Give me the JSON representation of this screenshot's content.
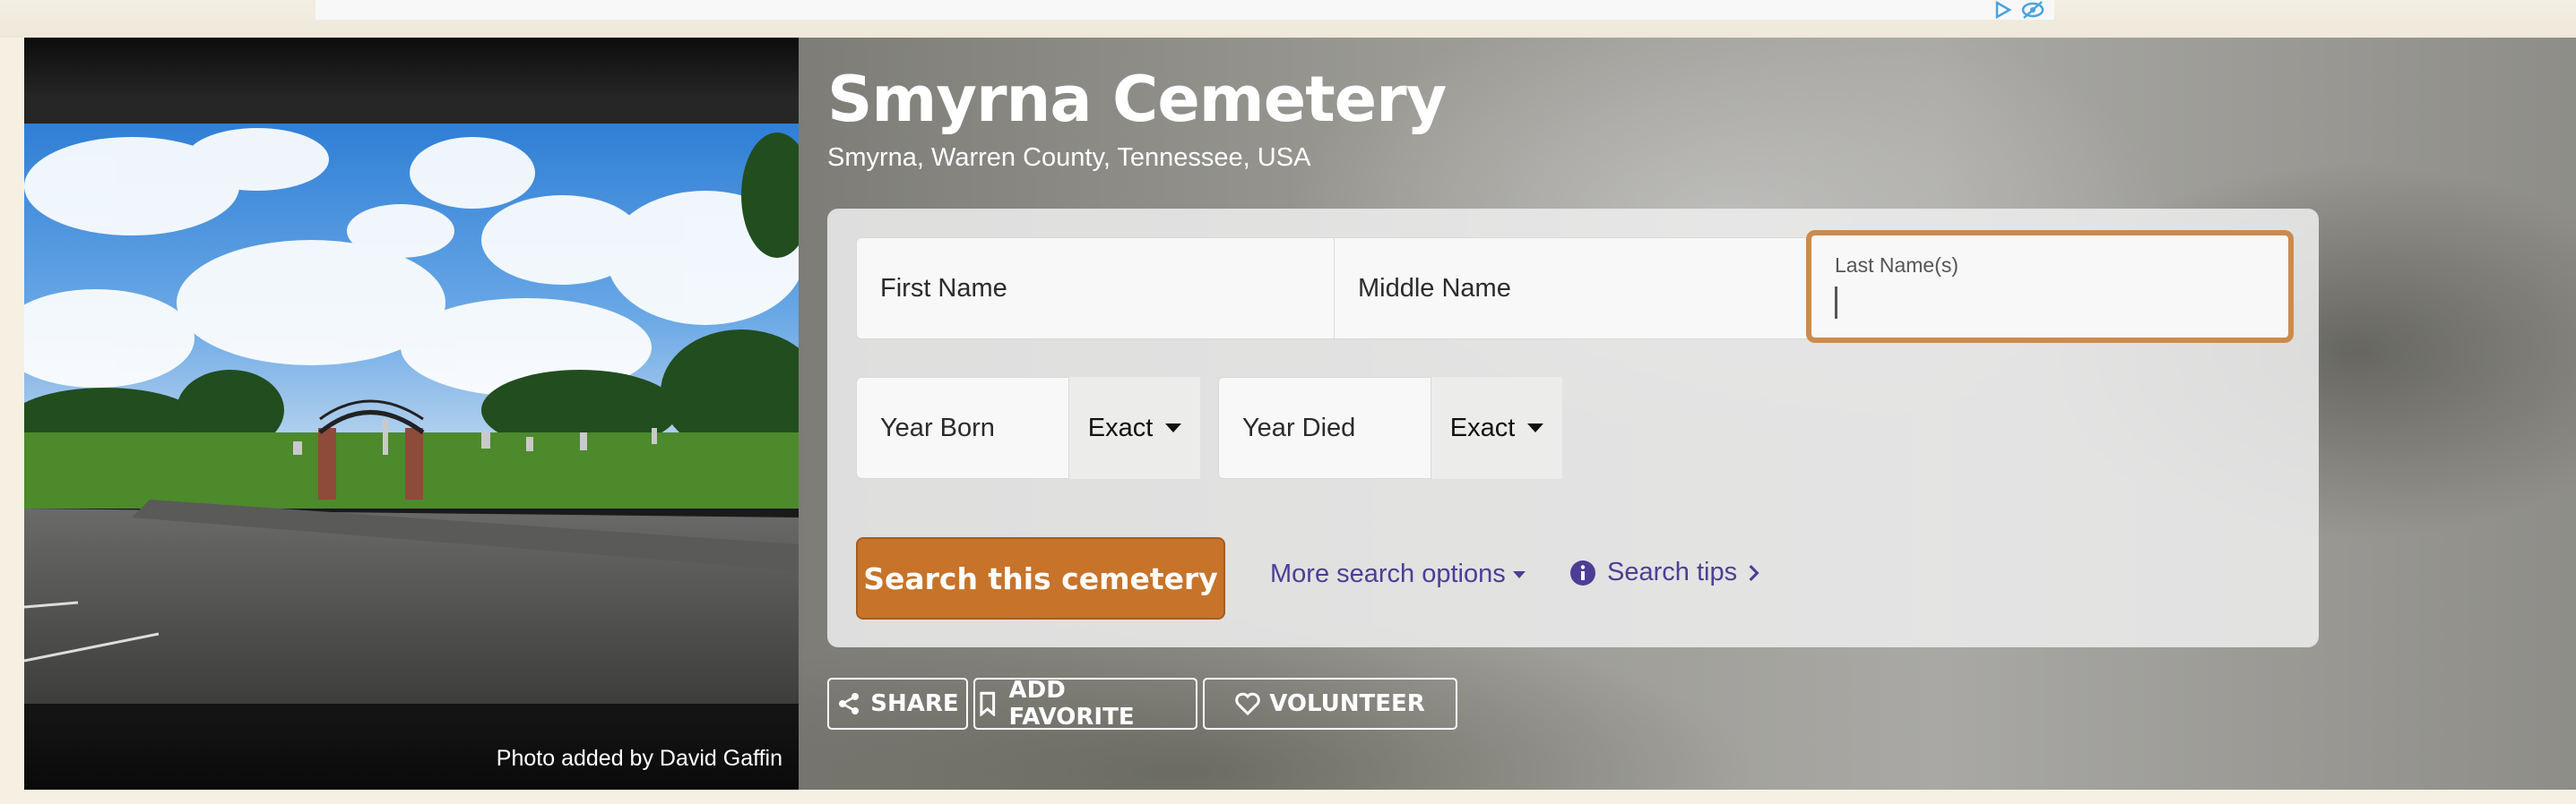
{
  "page": {
    "title": "Smyrna Cemetery",
    "location": "Smyrna, Warren County, Tennessee, USA",
    "photo_credit": "Photo added by David Gaffin"
  },
  "search": {
    "first_name_placeholder": "First Name",
    "middle_name_placeholder": "Middle Name",
    "last_name_label": "Last Name(s)",
    "last_name_value": "",
    "year_born_placeholder": "Year Born",
    "year_born_match": "Exact",
    "year_died_placeholder": "Year Died",
    "year_died_match": "Exact",
    "submit_label": "Search this cemetery",
    "more_options_label": "More search options",
    "tips_label": "Search tips"
  },
  "actions": {
    "share": "SHARE",
    "add_favorite": "ADD FAVORITE",
    "volunteer": "VOLUNTEER"
  },
  "colors": {
    "accent_orange": "#c7732a",
    "focus_ring": "#cc8a4d",
    "link_purple": "#4e3d95"
  },
  "icons": {
    "share": "share-icon",
    "favorite": "bookmark-icon",
    "volunteer": "heart-icon",
    "tips": "info-circle-icon",
    "chevron": "chevron-right-icon"
  }
}
